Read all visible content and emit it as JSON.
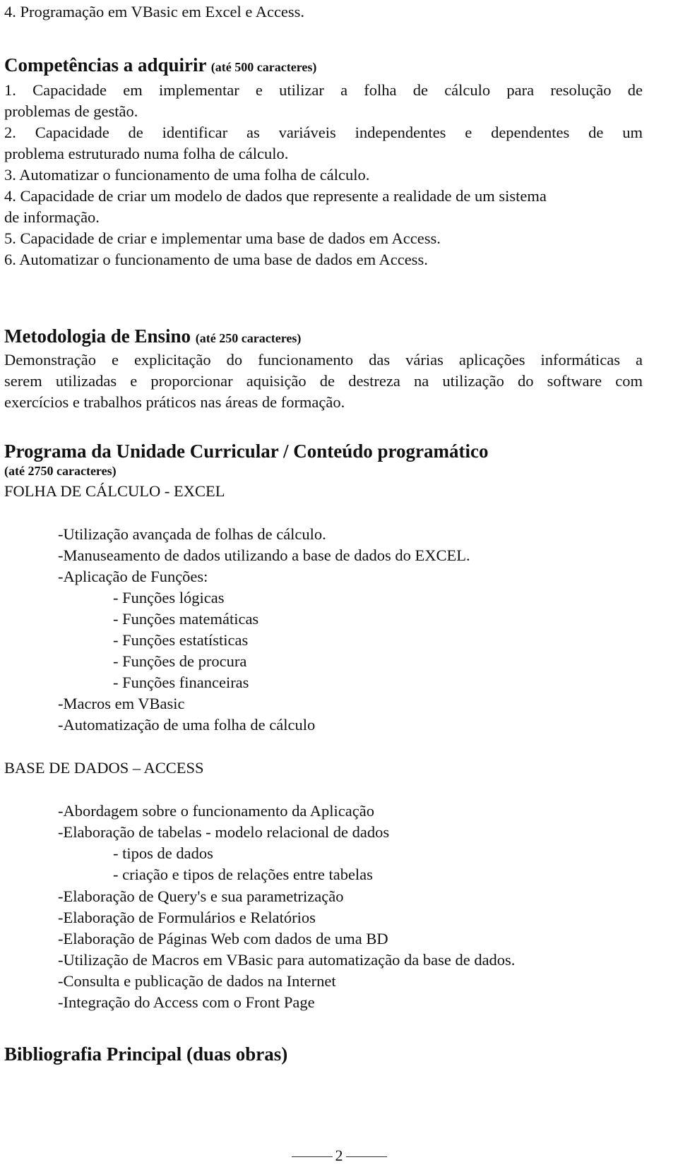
{
  "top_line": "4. Programação em VBasic em Excel e Access.",
  "competencias": {
    "title": "Competências a adquirir",
    "note": "(até 500 caracteres)",
    "items": [
      {
        "line1": "1. Capacidade em implementar e utilizar a folha de cálculo para resolução de",
        "line2": "problemas de gestão."
      },
      {
        "line1": "2. Capacidade de identificar as variáveis independentes e dependentes de um",
        "line2": "problema estruturado numa folha de cálculo."
      },
      {
        "line1": "3. Automatizar o funcionamento de uma folha de cálculo."
      },
      {
        "line1": "4. Capacidade de criar um modelo de dados que represente a realidade de um sistema",
        "line2": "de informação."
      },
      {
        "line1": "5. Capacidade de criar e implementar uma base de dados em Access."
      },
      {
        "line1": "6. Automatizar o funcionamento de uma base de dados em Access."
      }
    ]
  },
  "metodologia": {
    "title": "Metodologia de Ensino",
    "note": "(até 250 caracteres)",
    "lines": [
      "Demonstração e explicitação do funcionamento das várias aplicações informáticas a",
      "serem utilizadas e proporcionar aquisição de destreza na utilização do software com",
      "exercícios e trabalhos práticos nas áreas de formação."
    ]
  },
  "programa": {
    "title": "Programa da Unidade Curricular / Conteúdo programático",
    "note": "(até 2750 caracteres)",
    "excel": {
      "heading": "FOLHA DE CÁLCULO -  EXCEL",
      "items": [
        "-Utilização avançada de folhas de cálculo.",
        "-Manuseamento de dados utilizando a base de dados do EXCEL.",
        "-Aplicação de Funções:"
      ],
      "subitems": [
        "- Funções lógicas",
        "- Funções matemáticas",
        "- Funções estatísticas",
        "- Funções de procura",
        "- Funções financeiras"
      ],
      "items_after": [
        "-Macros em VBasic",
        "-Automatização de uma folha de cálculo"
      ]
    },
    "access": {
      "heading": "BASE DE DADOS – ACCESS",
      "items_before": [
        "-Abordagem sobre o funcionamento da Aplicação",
        "-Elaboração de tabelas - modelo relacional de dados"
      ],
      "subitems": [
        "- tipos de dados",
        "- criação e tipos de relações entre tabelas"
      ],
      "items_after": [
        "-Elaboração de Query's e sua parametrização",
        "-Elaboração de Formulários e Relatórios",
        "-Elaboração de Páginas Web com dados de uma BD",
        "-Utilização de Macros em VBasic para automatização da base de dados.",
        "-Consulta e publicação de dados na Internet",
        "-Integração do Access com o Front Page"
      ]
    }
  },
  "bibliografia": {
    "title": "Bibliografia Principal (duas obras)"
  },
  "page_number": "2"
}
